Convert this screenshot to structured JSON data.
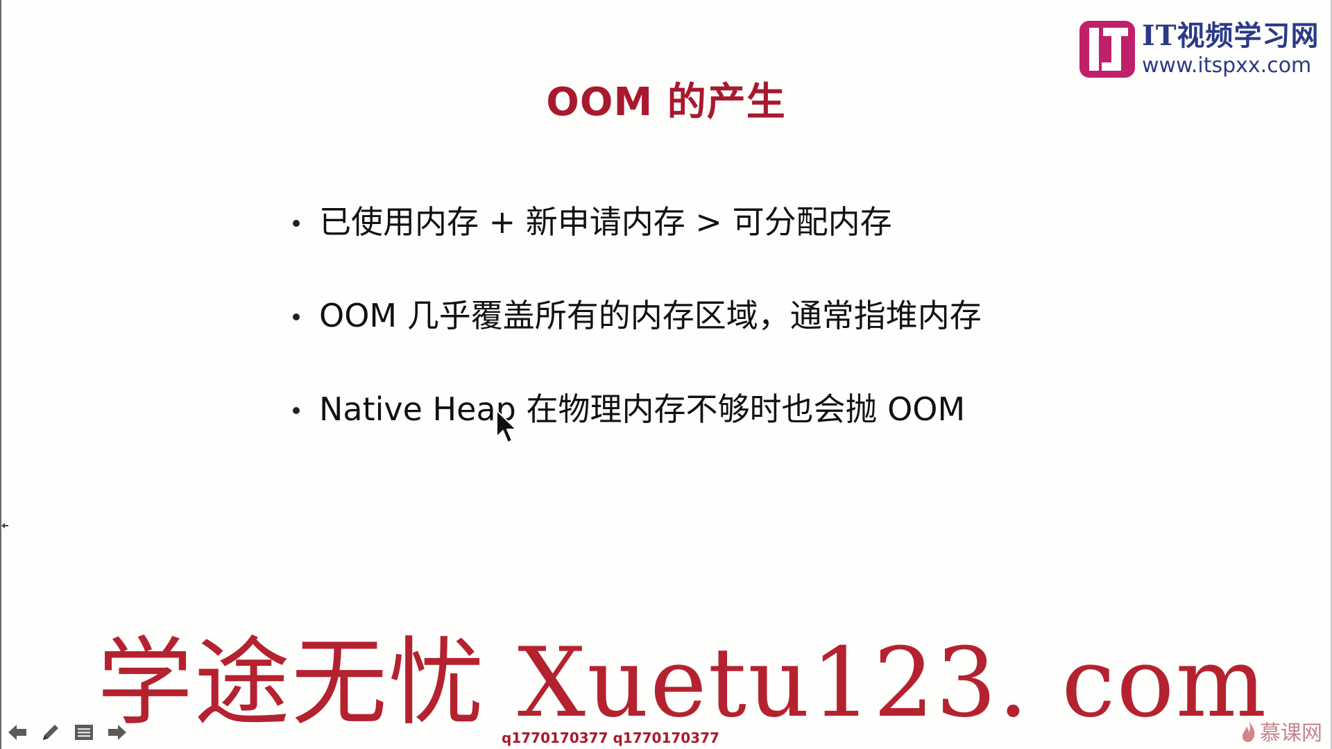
{
  "logo": {
    "title": "IT视频学习网",
    "url": "www.itspxx.com",
    "icon": "it-logo-icon"
  },
  "slide": {
    "title": "OOM 的产生",
    "bullets": [
      "已使用内存 + 新申请内存 > 可分配内存",
      "OOM 几乎覆盖所有的内存区域，通常指堆内存",
      "Native Heap 在物理内存不够时也会抛 OOM"
    ]
  },
  "watermark": {
    "text": "学途无忧 Xuetu123. com",
    "qq": "q1770170377 q1770170377"
  },
  "toolbar": {
    "icons": [
      "arrow-left-icon",
      "pen-icon",
      "menu-icon",
      "arrow-right-icon"
    ]
  },
  "brand": {
    "text": "慕课网",
    "icon": "flame-icon"
  },
  "colors": {
    "title": "#a8192e",
    "logo_blue": "#2a3a86",
    "logo_magenta": "#c0206a",
    "watermark": "#b5222f",
    "background": "#fefefc"
  }
}
